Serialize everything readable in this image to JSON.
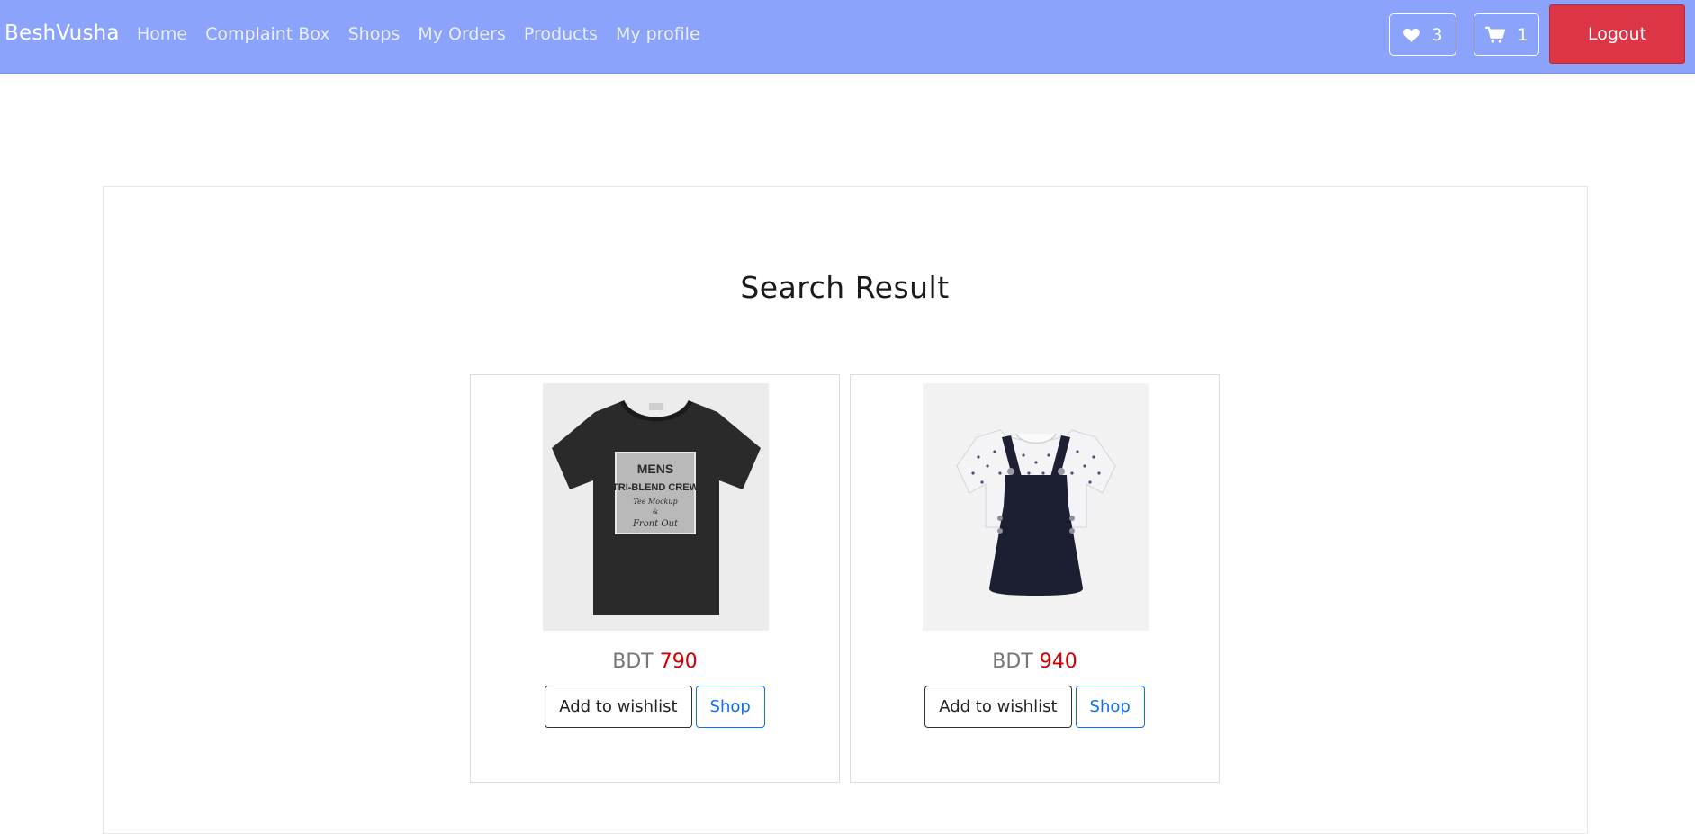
{
  "navbar": {
    "brand": "BeshVusha",
    "links": [
      {
        "label": "Home"
      },
      {
        "label": "Complaint Box"
      },
      {
        "label": "Shops"
      },
      {
        "label": "My Orders"
      },
      {
        "label": "Products"
      },
      {
        "label": "My profile"
      }
    ],
    "wishlist_count": "3",
    "cart_count": "1",
    "logout_label": "Logout",
    "background_color": "#8ca3fc",
    "logout_color": "#dc3545"
  },
  "page": {
    "title": "Search Result"
  },
  "products": [
    {
      "image_icon": "black-tshirt-image",
      "image_caption": [
        "MENS",
        "TRI-BLEND CREW",
        "Tee Mockup",
        "&",
        "Front Out"
      ],
      "currency": "BDT",
      "price": "790",
      "wishlist_label": "Add to wishlist",
      "shop_label": "Shop"
    },
    {
      "image_icon": "navy-pinafore-dress-image",
      "currency": "BDT",
      "price": "940",
      "wishlist_label": "Add to wishlist",
      "shop_label": "Shop"
    }
  ],
  "colors": {
    "price": "#d10000",
    "shop_button": "#0d6efd"
  }
}
